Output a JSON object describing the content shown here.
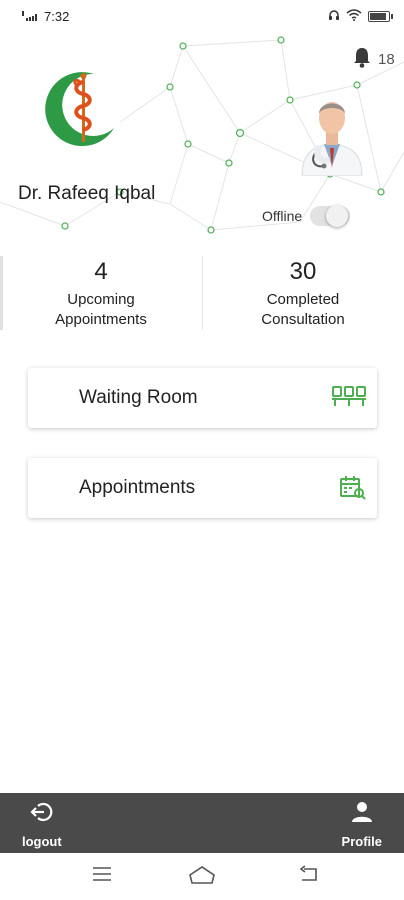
{
  "status_bar": {
    "time": "7:32",
    "icons": [
      "signal-icon",
      "headset-icon",
      "wifi-icon",
      "battery-icon"
    ],
    "battery_level": 0.8
  },
  "header": {
    "doctor_name": "Dr. Rafeeq Iqbal",
    "notification_count": "18",
    "status_label": "Offline",
    "status_on": false,
    "accent_color": "#4caf50"
  },
  "stats": [
    {
      "number": "4",
      "label_line1": "Upcoming",
      "label_line2": "Appointments"
    },
    {
      "number": "30",
      "label_line1": "Completed",
      "label_line2": "Consultation"
    }
  ],
  "menu": [
    {
      "label": "Waiting Room",
      "icon": "waiting-room-icon"
    },
    {
      "label": "Appointments",
      "icon": "calendar-search-icon"
    }
  ],
  "bottom_bar": {
    "logout_label": "logout",
    "profile_label": "Profile",
    "background": "#4a4a4a"
  },
  "system_nav": {
    "icons": [
      "menu-icon",
      "home-icon",
      "back-icon"
    ]
  }
}
